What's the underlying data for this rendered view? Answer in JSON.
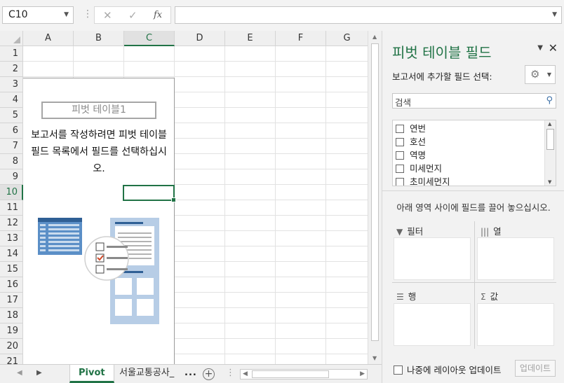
{
  "formula_bar": {
    "name_box": "C10",
    "fx_label": "fx",
    "formula": ""
  },
  "columns": [
    "A",
    "B",
    "C",
    "D",
    "E",
    "F",
    "G"
  ],
  "selected_column": "C",
  "rows": [
    "1",
    "2",
    "3",
    "4",
    "5",
    "6",
    "7",
    "8",
    "9",
    "10",
    "11",
    "12",
    "13",
    "14",
    "15",
    "16",
    "17",
    "18",
    "19",
    "20",
    "21"
  ],
  "selected_row": "10",
  "pivot_placeholder": {
    "name": "피벗 테이블1",
    "message": "보고서를 작성하려면 피벗 테이블 필드 목록에서 필드를 선택하십시오."
  },
  "sheet_tabs": {
    "active": "Pivot",
    "other": "서울교통공사_",
    "more": "..."
  },
  "pane": {
    "title": "피벗 테이블 필드",
    "choose_label": "보고서에 추가할 필드 선택:",
    "search_placeholder": "검색",
    "fields": [
      "연번",
      "호선",
      "역명",
      "미세먼지",
      "초미세먼지"
    ],
    "drag_hint": "아래 영역 사이에 필드를 끌어 놓으십시오.",
    "areas": {
      "filter": "필터",
      "columns": "열",
      "rows": "행",
      "values": "값"
    },
    "defer_label": "나중에 레이아웃 업데이트",
    "update_button": "업데이트"
  },
  "colors": {
    "accent": "#217346"
  },
  "icons": [
    "dropdown-icon",
    "cancel-icon",
    "enter-icon",
    "function-icon",
    "gear-icon",
    "close-icon",
    "search-icon",
    "filter-icon",
    "columns-icon",
    "rows-icon",
    "sigma-icon",
    "add-sheet-icon"
  ]
}
